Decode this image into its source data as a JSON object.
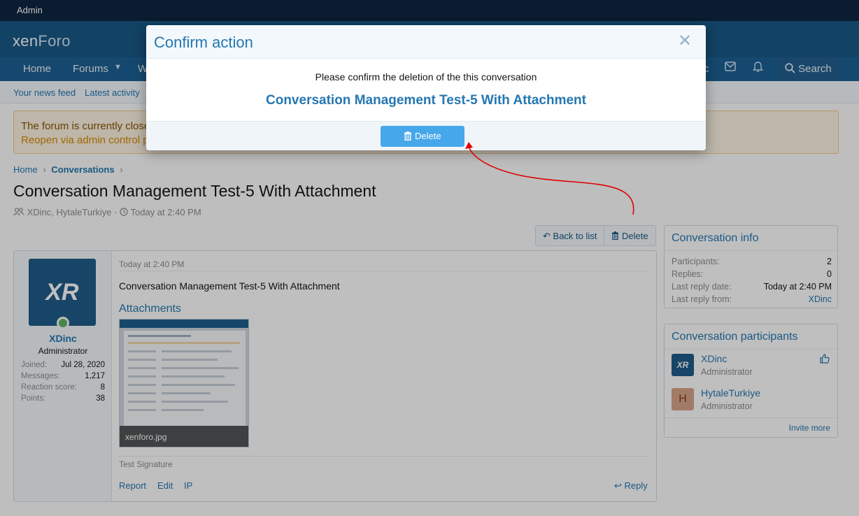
{
  "admin_bar": {
    "label": "Admin"
  },
  "header": {
    "logo_main": "xen",
    "logo_accent": "Foro",
    "nav": [
      {
        "label": "Home"
      },
      {
        "label": "Forums"
      },
      {
        "label": "W"
      }
    ],
    "nav_partial_right": "c",
    "search_label": "Search"
  },
  "subnav": {
    "items": [
      {
        "label": "Your news feed"
      },
      {
        "label": "Latest activity"
      }
    ]
  },
  "notice": {
    "line1": "The forum is currently close",
    "line2": "Reopen via admin control p"
  },
  "breadcrumb": {
    "home": "Home",
    "current": "Conversations"
  },
  "page": {
    "title": "Conversation Management Test-5 With Attachment",
    "participants": "XDinc, HytaleTurkiye",
    "separator": "·",
    "date": "Today at 2:40 PM"
  },
  "toolbar": {
    "back": "Back to list",
    "delete": "Delete"
  },
  "message": {
    "author": "XDinc",
    "author_title": "Administrator",
    "avatar_text": "XR",
    "stats": [
      {
        "label": "Joined:",
        "value": "Jul 28, 2020"
      },
      {
        "label": "Messages:",
        "value": "1,217"
      },
      {
        "label": "Reaction score:",
        "value": "8"
      },
      {
        "label": "Points:",
        "value": "38"
      }
    ],
    "date": "Today at 2:40 PM",
    "body": "Conversation Management Test-5 With Attachment",
    "attachments_heading": "Attachments",
    "attachment_name": "xenforo.jpg",
    "signature": "Test Signature",
    "actions": {
      "report": "Report",
      "edit": "Edit",
      "ip": "IP",
      "reply": "Reply"
    }
  },
  "conversation_info": {
    "title": "Conversation info",
    "rows": [
      {
        "label": "Participants:",
        "value": "2"
      },
      {
        "label": "Replies:",
        "value": "0"
      },
      {
        "label": "Last reply date:",
        "value": "Today at 2:40 PM"
      },
      {
        "label": "Last reply from:",
        "value": "XDinc"
      }
    ]
  },
  "participants": {
    "title": "Conversation participants",
    "list": [
      {
        "name": "XDinc",
        "role": "Administrator",
        "avatar": "XR"
      },
      {
        "name": "HytaleTurkiye",
        "role": "Administrator",
        "avatar": "H"
      }
    ],
    "invite": "Invite more"
  },
  "modal": {
    "title": "Confirm action",
    "close": "✕",
    "message": "Please confirm the deletion of the this conversation",
    "item": "Conversation Management Test-5 With Attachment",
    "delete_label": "Delete"
  },
  "colors": {
    "accent": "#2577b1",
    "header": "#185886",
    "button": "#47a7eb",
    "annotation_arrow": "#e00000"
  }
}
